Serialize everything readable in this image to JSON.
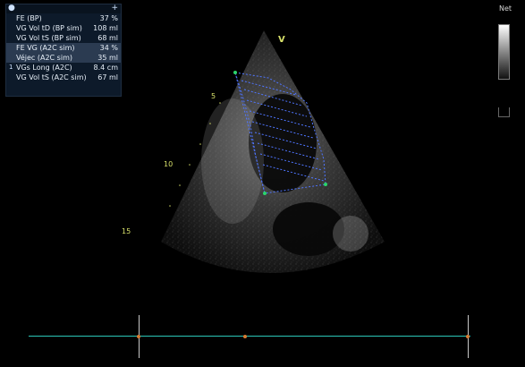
{
  "measurements": {
    "rows": [
      {
        "label": "FE (BP)",
        "value": "37 %",
        "highlight": false
      },
      {
        "label": "VG Vol tD (BP sim)",
        "value": "108 ml",
        "highlight": false
      },
      {
        "label": "VG Vol tS (BP sim)",
        "value": "68 ml",
        "highlight": false
      },
      {
        "label": "FE VG (A2C sim)",
        "value": "34 %",
        "highlight": true
      },
      {
        "label": "Véjec (A2C sim)",
        "value": "35 ml",
        "highlight": true
      },
      {
        "label": "VGs Long (A2C)",
        "value": "8.4 cm",
        "highlight": false,
        "bullet": "1"
      },
      {
        "label": "VG Vol tS (A2C sim)",
        "value": "67 ml",
        "highlight": false
      }
    ]
  },
  "ui": {
    "net_label": "Net",
    "orientation_marker": "V",
    "depth_ticks": [
      "5",
      "10",
      "15"
    ]
  },
  "colors": {
    "trace": "#4f75ff",
    "timeline": "#2cc6b7",
    "depth_text": "#d7e06a"
  }
}
